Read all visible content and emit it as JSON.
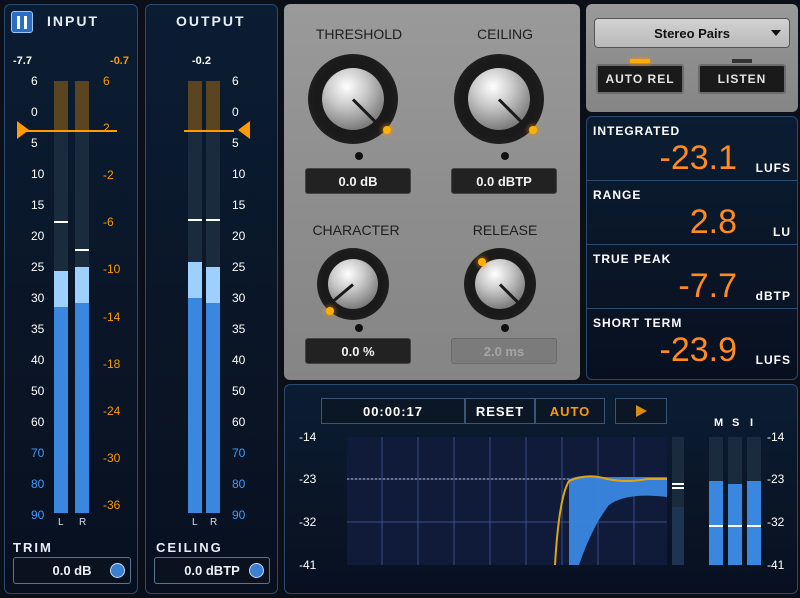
{
  "colors": {
    "accent_orange": "#ff9a00",
    "readout_orange": "#ff8a1f",
    "meter_blue": "#3a87e0",
    "meter_light_blue": "#9ed0ff",
    "panel_dark": "#0a1526",
    "metal_grey": "#8e8e8e"
  },
  "input": {
    "title": "INPUT",
    "icon": "meter-icon",
    "peak_left": "-7.7",
    "peak_right": "-0.7",
    "scale_left": [
      "6",
      "0",
      "5",
      "10",
      "15",
      "20",
      "25",
      "30",
      "35",
      "40",
      "50",
      "60",
      "70",
      "80",
      "90"
    ],
    "scale_right": [
      "6",
      "2",
      "-2",
      "-6",
      "-10",
      "-14",
      "-18",
      "-24",
      "-30",
      "-36"
    ],
    "channels": [
      "L",
      "R"
    ],
    "level_left_fraction": 0.56,
    "level_right_fraction": 0.57,
    "footer_label": "TRIM",
    "footer_value": "0.0 dB"
  },
  "output": {
    "title": "OUTPUT",
    "peak": "-0.2",
    "scale_right": [
      "6",
      "0",
      "5",
      "10",
      "15",
      "20",
      "25",
      "30",
      "35",
      "40",
      "50",
      "60",
      "70",
      "80",
      "90"
    ],
    "channels": [
      "L",
      "R"
    ],
    "level_left_fraction": 0.58,
    "level_right_fraction": 0.57,
    "footer_label": "CEILING",
    "footer_value": "0.0 dBTP"
  },
  "knobs": {
    "threshold": {
      "label": "THRESHOLD",
      "value": "0.0 dB"
    },
    "ceiling": {
      "label": "CEILING",
      "value": "0.0 dBTP"
    },
    "character": {
      "label": "CHARACTER",
      "value": "0.0 %"
    },
    "release": {
      "label": "RELEASE",
      "value": "2.0 ms"
    }
  },
  "mode": {
    "selected": "Stereo Pairs",
    "auto_rel_label": "AUTO REL",
    "auto_rel_on": true,
    "listen_label": "LISTEN",
    "listen_on": false
  },
  "loudness": [
    {
      "name": "INTEGRATED",
      "value": "-23.1",
      "unit": "LUFS"
    },
    {
      "name": "RANGE",
      "value": "2.8",
      "unit": "LU"
    },
    {
      "name": "TRUE PEAK",
      "value": "-7.7",
      "unit": "dBTP"
    },
    {
      "name": "SHORT TERM",
      "value": "-23.9",
      "unit": "LUFS"
    }
  ],
  "history": {
    "time": "00:00:17",
    "reset_label": "RESET",
    "auto_label": "AUTO",
    "play_icon": "play-icon",
    "y_labels": [
      "-14",
      "-23",
      "-32",
      "-41"
    ],
    "msi_labels": [
      "M",
      "S",
      "I"
    ],
    "msi_levels": [
      0.66,
      0.63,
      0.66
    ]
  }
}
